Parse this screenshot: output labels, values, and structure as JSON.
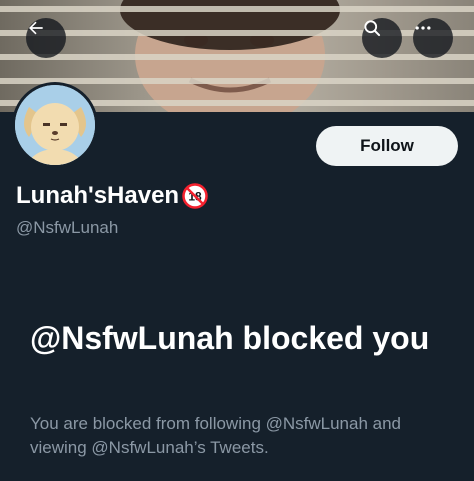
{
  "header": {
    "back_icon": "arrow-left-icon",
    "search_icon": "search-icon",
    "more_icon": "more-horizontal-icon"
  },
  "profile": {
    "display_name": "Lunah'sHaven",
    "age_badge": "18",
    "handle": "@NsfwLunah",
    "follow_label": "Follow"
  },
  "blocked": {
    "title": "@NsfwLunah blocked you",
    "description": "You are blocked from following @NsfwLunah and viewing @NsfwLunah’s Tweets."
  },
  "colors": {
    "background": "#15202b",
    "secondary_text": "#8b98a5",
    "follow_bg": "#eff3f4",
    "badge_red": "#f4212e"
  }
}
